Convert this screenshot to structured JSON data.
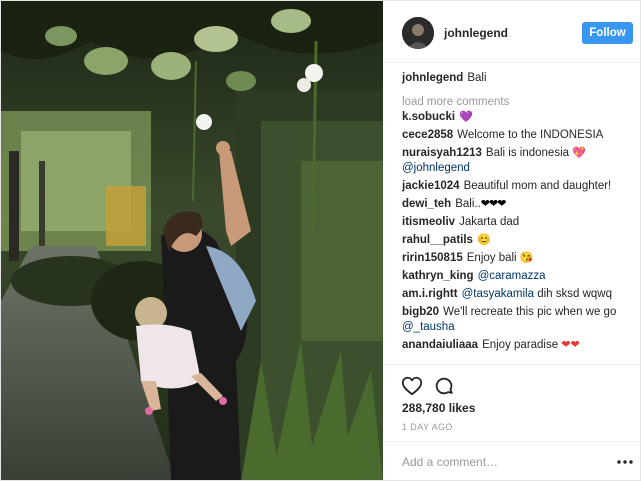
{
  "post": {
    "owner": "johnlegend",
    "follow_label": "Follow",
    "caption_user": "johnlegend",
    "caption_text": "Bali",
    "load_more": "load more comments",
    "comments": [
      {
        "user": "k.sobucki",
        "text": "",
        "emoji": "💜"
      },
      {
        "user": "cece2858",
        "text": "Welcome to the INDONESIA"
      },
      {
        "user": "nuraisyah1213",
        "text": "Bali is indonesia",
        "emoji": "💖",
        "mention": "@johnlegend"
      },
      {
        "user": "jackie1024",
        "text": "Beautiful mom and daughter!"
      },
      {
        "user": "dewi_teh",
        "text": "Bali..",
        "emoji": "❤❤❤"
      },
      {
        "user": "itismeoliv",
        "text": "Jakarta dad"
      },
      {
        "user": "rahul__patils",
        "text": "",
        "emoji": "😊"
      },
      {
        "user": "ririn150815",
        "text": "Enjoy bali",
        "emoji": "😘"
      },
      {
        "user": "kathryn_king",
        "text": "",
        "mention": "@caramazza"
      },
      {
        "user": "am.i.rightt",
        "mention": "@tasyakamila",
        "text": "dih sksd wqwq"
      },
      {
        "user": "bigb20",
        "text": "We'll recreate this pic when we go",
        "mention": "@_tausha"
      },
      {
        "user": "anandaiuliaaa",
        "text": "Enjoy paradise",
        "emoji": "❤❤"
      }
    ],
    "likes": "288,780 likes",
    "time": "1 DAY AGO",
    "comment_placeholder": "Add a comment…"
  },
  "icons": {
    "like": "heart-outline-icon",
    "comment": "speech-bubble-icon",
    "more": "more-options-icon"
  },
  "colors": {
    "follow_button": "#3897f0",
    "mention": "#003569",
    "muted": "#999999",
    "text": "#262626"
  }
}
